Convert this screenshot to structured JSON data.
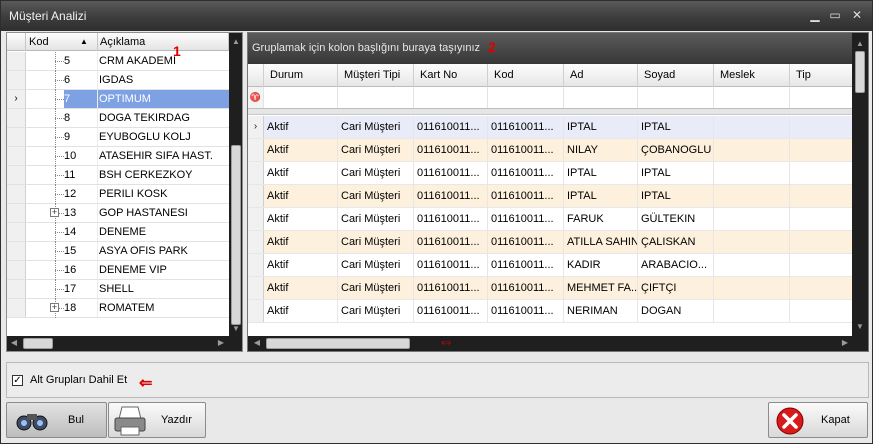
{
  "window": {
    "title": "Müşteri Analizi",
    "min": "▁",
    "max": "▭",
    "close": "✕"
  },
  "left_grid": {
    "headers": {
      "kod": "Kod",
      "aciklama": "Açıklama",
      "sort": "▲"
    },
    "rows": [
      {
        "kod": "5",
        "aciklama": "CRM AKADEMI",
        "exp": ""
      },
      {
        "kod": "6",
        "aciklama": "IGDAS",
        "exp": ""
      },
      {
        "kod": "7",
        "aciklama": "OPTIMUM",
        "exp": "",
        "ind": "›"
      },
      {
        "kod": "8",
        "aciklama": "DOGA TEKIRDAG",
        "exp": ""
      },
      {
        "kod": "9",
        "aciklama": "EYUBOGLU KOLJ",
        "exp": ""
      },
      {
        "kod": "10",
        "aciklama": "ATASEHIR SIFA HAST.",
        "exp": ""
      },
      {
        "kod": "11",
        "aciklama": "BSH CERKEZKOY",
        "exp": ""
      },
      {
        "kod": "12",
        "aciklama": "PERILI KOSK",
        "exp": ""
      },
      {
        "kod": "13",
        "aciklama": "GOP HASTANESI",
        "exp": "+"
      },
      {
        "kod": "14",
        "aciklama": "DENEME",
        "exp": ""
      },
      {
        "kod": "15",
        "aciklama": "ASYA OFIS PARK",
        "exp": ""
      },
      {
        "kod": "16",
        "aciklama": "DENEME VIP",
        "exp": ""
      },
      {
        "kod": "17",
        "aciklama": "SHELL",
        "exp": ""
      },
      {
        "kod": "18",
        "aciklama": "ROMATEM",
        "exp": "+"
      }
    ]
  },
  "annotations": {
    "one": "1",
    "two": "2",
    "arrow_h": "⇔",
    "arrow_l": "⇐"
  },
  "right_grid": {
    "group_text": "Gruplamak için kolon başlığını buraya taşıyınız",
    "filter_icon": "♈",
    "columns": [
      "Durum",
      "Müşteri Tipi",
      "Kart No",
      "Kod",
      "Ad",
      "Soyad",
      "Meslek",
      "Tip"
    ],
    "rows": [
      {
        "ind": "›",
        "c": [
          "Aktif",
          "Cari Müşteri",
          "011610011...",
          "011610011...",
          "IPTAL",
          "IPTAL",
          "",
          ""
        ]
      },
      {
        "ind": "",
        "c": [
          "Aktif",
          "Cari Müşteri",
          "011610011...",
          "011610011...",
          "NILAY",
          "ÇOBANOGLU",
          "",
          ""
        ]
      },
      {
        "ind": "",
        "c": [
          "Aktif",
          "Cari Müşteri",
          "011610011...",
          "011610011...",
          "IPTAL",
          "IPTAL",
          "",
          ""
        ]
      },
      {
        "ind": "",
        "c": [
          "Aktif",
          "Cari Müşteri",
          "011610011...",
          "011610011...",
          "IPTAL",
          "IPTAL",
          "",
          ""
        ]
      },
      {
        "ind": "",
        "c": [
          "Aktif",
          "Cari Müşteri",
          "011610011...",
          "011610011...",
          "FARUK",
          "GÜLTEKIN",
          "",
          ""
        ]
      },
      {
        "ind": "",
        "c": [
          "Aktif",
          "Cari Müşteri",
          "011610011...",
          "011610011...",
          "ATILLA SAHIN",
          "ÇALISKAN",
          "",
          ""
        ]
      },
      {
        "ind": "",
        "c": [
          "Aktif",
          "Cari Müşteri",
          "011610011...",
          "011610011...",
          "KADIR",
          "ARABACIO...",
          "",
          ""
        ]
      },
      {
        "ind": "",
        "c": [
          "Aktif",
          "Cari Müşteri",
          "011610011...",
          "011610011...",
          "MEHMET FA...",
          "ÇIFTÇI",
          "",
          ""
        ]
      },
      {
        "ind": "",
        "c": [
          "Aktif",
          "Cari Müşteri",
          "011610011...",
          "011610011...",
          "NERIMAN",
          "DOGAN",
          "",
          ""
        ]
      }
    ]
  },
  "checkbox": {
    "label": "Alt Grupları Dahil Et",
    "check": "✓"
  },
  "buttons": {
    "bul": "Bul",
    "yazdir": "Yazdır",
    "kapat": "Kapat"
  }
}
